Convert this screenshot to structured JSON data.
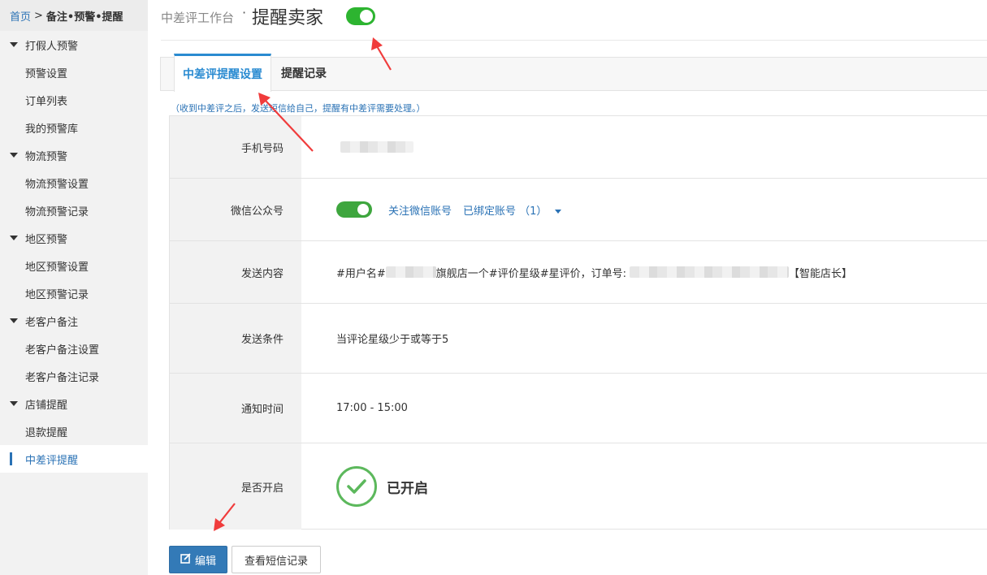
{
  "breadcrumb": {
    "home": "首页",
    "separator": ">",
    "current": "备注•预警•提醒"
  },
  "sidebar": {
    "items": [
      {
        "type": "group",
        "label": "打假人预警"
      },
      {
        "type": "item",
        "label": "预警设置"
      },
      {
        "type": "item",
        "label": "订单列表"
      },
      {
        "type": "item",
        "label": "我的预警库"
      },
      {
        "type": "group",
        "label": "物流预警"
      },
      {
        "type": "item",
        "label": "物流预警设置"
      },
      {
        "type": "item",
        "label": "物流预警记录"
      },
      {
        "type": "group",
        "label": "地区预警"
      },
      {
        "type": "item",
        "label": "地区预警设置"
      },
      {
        "type": "item",
        "label": "地区预警记录"
      },
      {
        "type": "group",
        "label": "老客户备注"
      },
      {
        "type": "item",
        "label": "老客户备注设置"
      },
      {
        "type": "item",
        "label": "老客户备注记录"
      },
      {
        "type": "group",
        "label": "店铺提醒"
      },
      {
        "type": "item",
        "label": "退款提醒"
      },
      {
        "type": "item",
        "label": "中差评提醒",
        "active": true
      }
    ]
  },
  "header": {
    "subtitle": "中差评工作台",
    "dot": "·",
    "title": "提醒卖家",
    "toggle_on": true
  },
  "tabs": [
    {
      "label": "中差评提醒设置",
      "active": true
    },
    {
      "label": "提醒记录"
    }
  ],
  "hint": "（收到中差评之后，发送短信给自己，提醒有中差评需要处理。）",
  "form": {
    "phone": {
      "label": "手机号码"
    },
    "wechat": {
      "label": "微信公众号",
      "follow_link": "关注微信账号",
      "bound": "已绑定账号 （1）"
    },
    "content": {
      "label": "发送内容",
      "prefix": "#用户名#",
      "mid": "旗舰店一个#评价星级#星评价，订单号:",
      "suffix": "【智能店长】"
    },
    "condition": {
      "label": "发送条件",
      "value": "当评论星级少于或等于5"
    },
    "time": {
      "label": "通知时间",
      "value": "17:00 - 15:00"
    },
    "enabled": {
      "label": "是否开启",
      "value": "已开启"
    }
  },
  "buttons": {
    "edit": "编辑",
    "sms_log": "查看短信记录"
  },
  "colors": {
    "accent": "#2a72b5",
    "toggle": "#2db430",
    "check": "#5cb85c",
    "primary_button": "#337ab7",
    "annotation_arrow": "#f03c3c"
  }
}
